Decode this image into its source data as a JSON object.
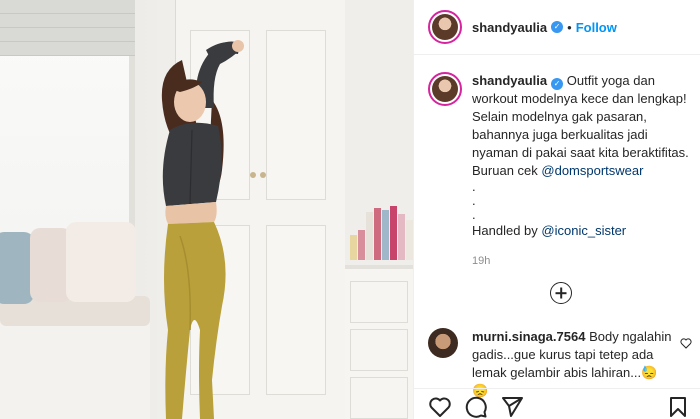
{
  "post": {
    "username": "shandyaulia",
    "verified_icon": "verified-badge-icon",
    "separator": "•",
    "follow_label": "Follow"
  },
  "caption": {
    "username": "shandyaulia",
    "text": "Outfit yoga dan workout modelnya kece dan lengkap! Selain modelnya gak pasaran, bahannya juga berkualitas jadi nyaman di pakai saat kita beraktifitas. Buruan cek",
    "mention": "@domsportswear",
    "dots": [
      ".",
      ".",
      "."
    ],
    "handled_prefix": "Handled by",
    "handled_mention": "@iconic_sister",
    "time": "19h"
  },
  "load_more_icon": "plus-circle-icon",
  "comment": {
    "username": "murni.sinaga.7564",
    "text": "Body ngalahin gadis...gue kurus tapi tetep ada lemak gelambir abis lahiran...😓😞"
  },
  "actions": {
    "like_icon": "heart-icon",
    "comment_icon": "comment-icon",
    "share_icon": "share-icon",
    "save_icon": "bookmark-icon"
  },
  "colors": {
    "accent": "#0095f6",
    "mention": "#00376b",
    "verified": "#3897f0",
    "leggings": "#b9a03a",
    "top": "#3a3b3f"
  }
}
